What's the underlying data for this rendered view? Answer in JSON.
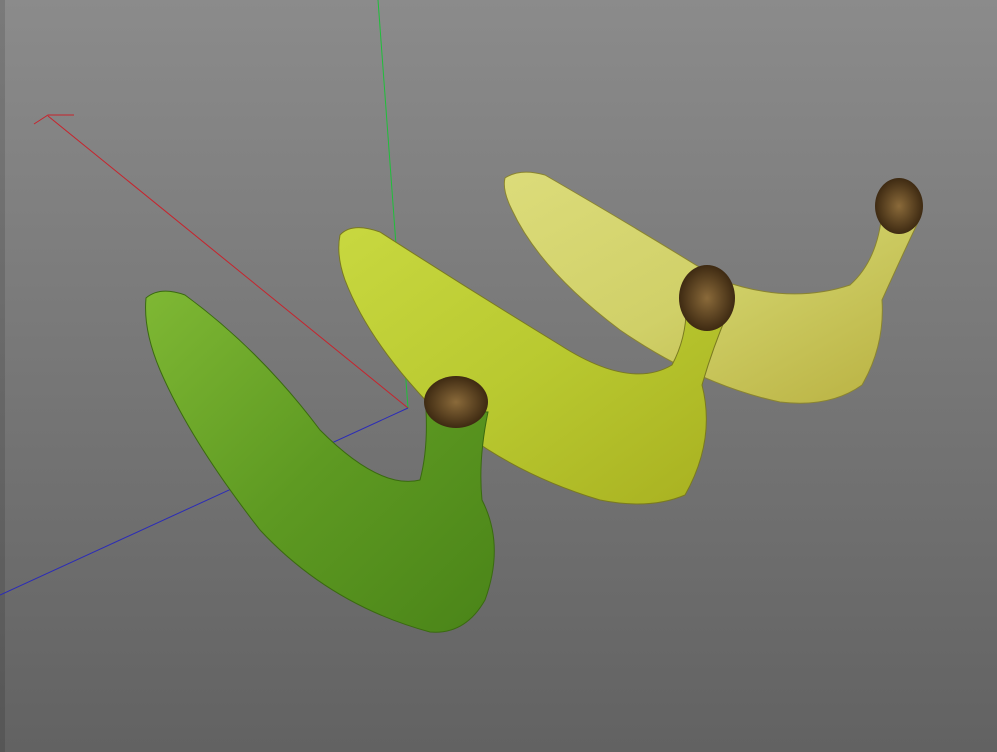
{
  "viewport": {
    "background_top": "#8b8b8b",
    "background_bottom": "#626262",
    "axes": [
      {
        "name": "x-axis",
        "color": "#c8232c"
      },
      {
        "name": "y-axis",
        "color": "#1fbf3a"
      },
      {
        "name": "z-axis",
        "color": "#2b2bb8"
      }
    ],
    "objects": [
      {
        "name": "green-banana",
        "color": "#6fa827"
      },
      {
        "name": "yellow-green-banana",
        "color": "#c4d33c"
      },
      {
        "name": "yellow-banana",
        "color": "#d4d66a"
      }
    ],
    "stem_color": "#5a3e1e"
  }
}
